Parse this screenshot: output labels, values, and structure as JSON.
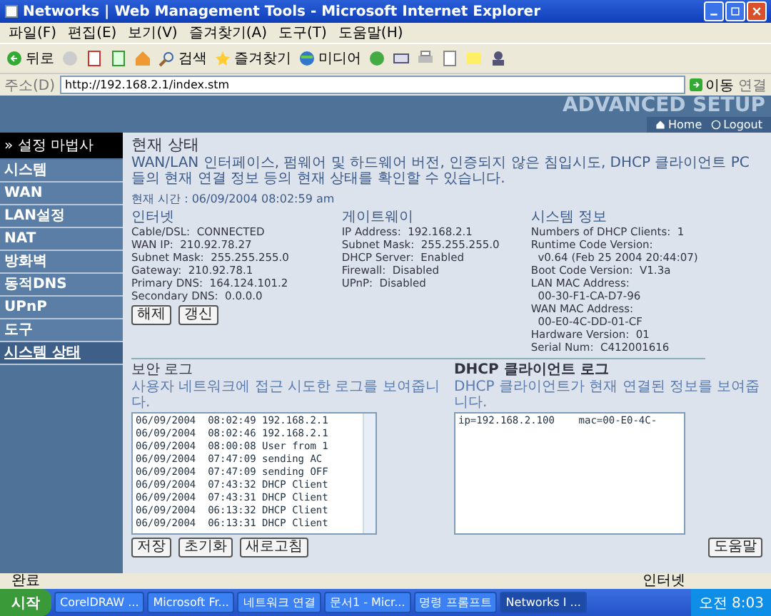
{
  "window": {
    "title": "Networks | Web Management Tools - Microsoft Internet Explorer"
  },
  "menu": [
    "파일(F)",
    "편집(E)",
    "보기(V)",
    "즐겨찾기(A)",
    "도구(T)",
    "도움말(H)"
  ],
  "toolbar": {
    "back": "뒤로",
    "search": "검색",
    "favorites": "즐겨찾기",
    "media": "미디어"
  },
  "address": {
    "label": "주소(D)",
    "url": "http://192.168.2.1/index.stm",
    "go": "이동",
    "links": "연결"
  },
  "banner": {
    "title": "ADVANCED SETUP",
    "home": "Home",
    "logout": "Logout"
  },
  "sidebar": {
    "header": "» 설정 마법사",
    "items": [
      {
        "label": "시스템",
        "selected": false
      },
      {
        "label": "WAN",
        "selected": false
      },
      {
        "label": "LAN설정",
        "selected": false
      },
      {
        "label": "NAT",
        "selected": false
      },
      {
        "label": "방화벽",
        "selected": false
      },
      {
        "label": "동적DNS",
        "selected": false
      },
      {
        "label": "UPnP",
        "selected": false
      },
      {
        "label": "도구",
        "selected": false
      },
      {
        "label": "시스템 상태",
        "selected": true
      }
    ]
  },
  "page": {
    "title": "현재 상태",
    "description": "WAN/LAN 인터페이스, 펌웨어 및 하드웨어 버전, 인증되지 않은 침입시도, DHCP 클라이언트 PC들의 현재 연결 정보 등의 현재 상태를 확인할 수 있습니다.",
    "time": "현재 시간 : 06/09/2004 08:02:59 am"
  },
  "columns": [
    {
      "title": "인터넷",
      "lines": [
        "Cable/DSL:  CONNECTED",
        "WAN IP:  210.92.78.27",
        "Subnet Mask:  255.255.255.0",
        "Gateway:  210.92.78.1",
        "Primary DNS:  164.124.101.2",
        "Secondary DNS:  0.0.0.0"
      ],
      "buttons": [
        "해제",
        "갱신"
      ]
    },
    {
      "title": "게이트웨이",
      "lines": [
        "IP Address:  192.168.2.1",
        "Subnet Mask:  255.255.255.0",
        "DHCP Server:  Enabled",
        "Firewall:  Disabled",
        "UPnP:  Disabled"
      ]
    },
    {
      "title": "시스템 정보",
      "lines": [
        "Numbers of DHCP Clients:  1",
        "Runtime Code Version:",
        "  v0.64 (Feb 25 2004 20:44:07)",
        "Boot Code Version:  V1.3a",
        "LAN MAC Address:",
        "  00-30-F1-CA-D7-96",
        "WAN MAC Address:",
        "  00-E0-4C-DD-01-CF",
        "Hardware Version:  01",
        "Serial Num:  C412001616"
      ]
    }
  ],
  "security_log": {
    "title": "보안 로그",
    "subtitle": "사용자 네트워크에 접근 시도한 로그를 보여줍니다.",
    "entries": [
      "06/09/2004  08:02:49 192.168.2.1",
      "06/09/2004  08:02:46 192.168.2.1",
      "06/09/2004  08:00:08 User from 1",
      "06/09/2004  07:47:09 sending AC",
      "06/09/2004  07:47:09 sending OFF",
      "06/09/2004  07:43:32 DHCP Client",
      "06/09/2004  07:43:31 DHCP Client",
      "06/09/2004  06:13:32 DHCP Client",
      "06/09/2004  06:13:31 DHCP Client"
    ],
    "buttons": [
      "저장",
      "초기화",
      "새로고침"
    ]
  },
  "dhcp_log": {
    "title": "DHCP 클라이언트 로그",
    "subtitle": "DHCP 클라이언트가 현재 연결된 정보를 보여줍니다.",
    "entries": [
      "ip=192.168.2.100    mac=00-E0-4C-"
    ]
  },
  "help_button": "도움말",
  "status_bar": {
    "text": "완료",
    "zone": "인터넷"
  },
  "taskbar": {
    "start": "시작",
    "tasks": [
      {
        "label": "CorelDRAW ...",
        "selected": false
      },
      {
        "label": "Microsoft Fr...",
        "selected": false
      },
      {
        "label": "네트워크 연결",
        "selected": false
      },
      {
        "label": "문서1 - Micr...",
        "selected": false
      },
      {
        "label": "명령 프롬프트",
        "selected": false
      },
      {
        "label": "Networks I ...",
        "selected": true
      }
    ],
    "clock": "오전 8:03"
  }
}
